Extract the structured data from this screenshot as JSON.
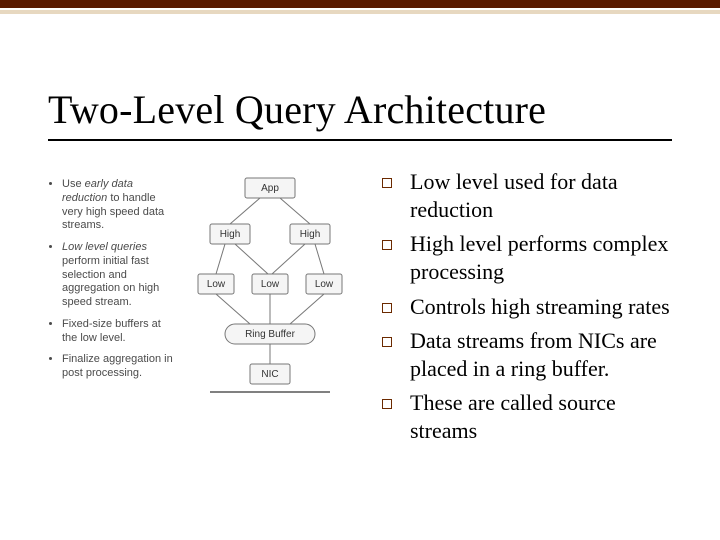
{
  "title": "Two-Level Query Architecture",
  "notes": {
    "items": [
      {
        "pre": "Use ",
        "em": "early data reduction",
        "post": " to handle very high speed data streams."
      },
      {
        "pre": "",
        "em": "Low level queries",
        "post": " perform initial fast selection and aggregation on high speed stream."
      },
      {
        "pre": "Fixed-size buffers at the low level.",
        "em": "",
        "post": ""
      },
      {
        "pre": "Finalize aggregation in post processing.",
        "em": "",
        "post": ""
      }
    ]
  },
  "diagram": {
    "app": "App",
    "high1": "High",
    "high2": "High",
    "low1": "Low",
    "low2": "Low",
    "low3": "Low",
    "ring": "Ring Buffer",
    "nic": "NIC"
  },
  "bullets": [
    "Low level used for data reduction",
    "High level performs complex processing",
    "Controls high streaming rates",
    "Data streams from NICs are placed in a ring buffer.",
    "These are called source streams"
  ]
}
